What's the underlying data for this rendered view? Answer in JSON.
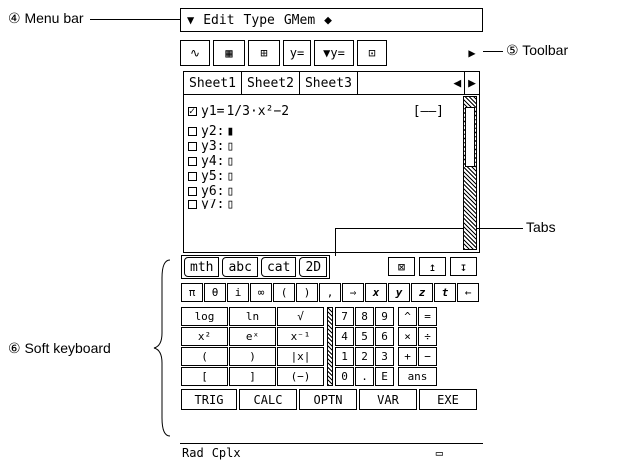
{
  "callouts": {
    "menu_bar": "④ Menu bar",
    "toolbar": "⑤ Toolbar",
    "tabs": "Tabs",
    "soft_keyboard": "⑥ Soft keyboard"
  },
  "menubar": {
    "icon": "▼",
    "items": [
      "Edit",
      "Type",
      "GMem",
      "◆"
    ]
  },
  "toolbar": {
    "buttons": [
      "∿",
      "▦",
      "⊞",
      "y=",
      "▼y=",
      "⊡",
      "▶"
    ]
  },
  "sheets": {
    "tabs": [
      "Sheet1",
      "Sheet2",
      "Sheet3"
    ],
    "arrows": [
      "◀",
      "▶"
    ]
  },
  "equations": [
    {
      "label": "y1=",
      "expr": "1/3·x²−2",
      "checked": true,
      "style": "[——]"
    },
    {
      "label": "y2:",
      "expr": "▮",
      "checked": false
    },
    {
      "label": "y3:",
      "expr": "▯",
      "checked": false
    },
    {
      "label": "y4:",
      "expr": "▯",
      "checked": false
    },
    {
      "label": "y5:",
      "expr": "▯",
      "checked": false
    },
    {
      "label": "y6:",
      "expr": "▯",
      "checked": false
    },
    {
      "label": "y7:",
      "expr": "▯",
      "checked": false
    }
  ],
  "keyboard": {
    "tabs": [
      "mth",
      "abc",
      "cat",
      "2D"
    ],
    "nav": [
      "⊠",
      "↥",
      "↧"
    ],
    "row0": [
      "π",
      "θ",
      "i",
      "∞",
      "(",
      ")",
      ",",
      "⇒",
      "x",
      "y",
      "z",
      "t",
      "←"
    ],
    "left_rows": [
      [
        "log",
        "ln",
        "√"
      ],
      [
        "x²",
        "eˣ",
        "x⁻¹"
      ],
      [
        "(",
        ")",
        "|x|"
      ],
      [
        "[",
        "]",
        "(−)"
      ]
    ],
    "num_rows": [
      [
        "7",
        "8",
        "9",
        "^",
        "="
      ],
      [
        "4",
        "5",
        "6",
        "×",
        "÷"
      ],
      [
        "1",
        "2",
        "3",
        "+",
        "−"
      ],
      [
        "0",
        ".",
        "E",
        "ans"
      ]
    ],
    "bottom": [
      "TRIG",
      "CALC",
      "OPTN",
      "VAR",
      "EXE"
    ]
  },
  "status": {
    "angle": "Rad",
    "mode": "Cplx",
    "battery": "▭"
  }
}
